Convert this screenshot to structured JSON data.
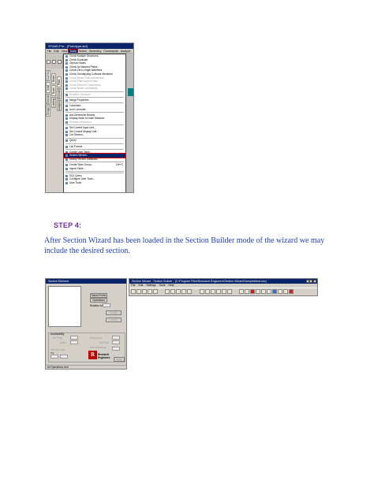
{
  "screenshot_menu": {
    "title": "STAAD.Pro - [Prototype.std]",
    "menubar": [
      "File",
      "Edit",
      "View",
      "Tools",
      "Select",
      "Geometry",
      "Commands",
      "Analyze",
      "Mode",
      "Window",
      "Help"
    ],
    "active_menu_index": 3,
    "vertical_tabs": [
      "Modeling",
      "Beam",
      "Plate",
      "Solid",
      "Node",
      "Geometry",
      "General",
      "Loading",
      "Analysis",
      "Design"
    ],
    "selected_tab_index": 0,
    "items": [
      {
        "label": "Check Multiple Structures...",
        "disabled": false
      },
      {
        "label": "Check Duplicate",
        "disabled": false
      },
      {
        "label": "Orphan Nodes",
        "disabled": false
      },
      {
        "label": "Check for Warped Plates...",
        "disabled": false
      },
      {
        "label": "Check Zero Length Members",
        "disabled": false
      },
      {
        "label": "Check Overlapping Collinear Members",
        "disabled": false
      },
      {
        "label": "Check Beam-Plate Intersection",
        "disabled": true
      },
      {
        "label": "Check Plate Aspect Ratio",
        "disabled": true
      },
      {
        "label": "Check Element Connectivity",
        "disabled": true
      },
      {
        "label": "Check Node Connectivity",
        "disabled": true
      },
      {
        "sep": true
      },
      {
        "label": "Redefine Structure",
        "disabled": true
      },
      {
        "sep": true
      },
      {
        "label": "Merge Properties",
        "disabled": false
      },
      {
        "sep": true
      },
      {
        "label": "Calculator...",
        "disabled": false
      },
      {
        "label": "Unit Converter...",
        "disabled": false
      },
      {
        "sep": true
      },
      {
        "label": "Ask Dimension Beams",
        "disabled": false
      },
      {
        "label": "Display Node to Node Distance",
        "disabled": false
      },
      {
        "label": "Remove Dimension",
        "disabled": true
      },
      {
        "sep": true
      },
      {
        "label": "Set Current Input Unit...",
        "disabled": false
      },
      {
        "label": "Set Current Display Unit...",
        "disabled": false
      },
      {
        "label": "Cut Section...",
        "disabled": false
      },
      {
        "sep": true
      },
      {
        "label": "Query",
        "disabled": false
      },
      {
        "sep": true
      },
      {
        "label": "List Format...",
        "disabled": false
      },
      {
        "sep": true
      },
      {
        "label": "Create User Table...",
        "disabled": false
      },
      {
        "label": "Section Wizard...",
        "disabled": false,
        "highlight": true
      },
      {
        "label": "Modify Section Database...",
        "disabled": false
      },
      {
        "sep": true
      },
      {
        "label": "Create Spec Group...",
        "disabled": false,
        "shortcut": "Ctrl+G"
      },
      {
        "label": "Import Table...",
        "disabled": false
      },
      {
        "sep": true
      },
      {
        "sep": true
      },
      {
        "label": "SQL Query",
        "disabled": false
      },
      {
        "label": "Configure User Tools...",
        "disabled": false
      },
      {
        "label": "User Tools",
        "disabled": false
      }
    ]
  },
  "step_label": "STEP 4:",
  "paragraph": "After Section Wizard has been loaded in the Section Builder mode of the wizard we may include the desired section.",
  "screenshot_dialog": {
    "title": "Section Element",
    "buttons": {
      "select_profile": "Select Profile",
      "operations": "Operations",
      "modify": "Modify",
      "delete": "Delete"
    },
    "rotation_label": "Rotation Angle",
    "group_title": "Accessibility",
    "labels": {
      "cut_point": "Cut Point",
      "width": "width",
      "edge_point": "Edge point",
      "with_fold": "with fold",
      "with_shift_along": "with shift along",
      "into_the_point": "into the point",
      "x_y": "x    y"
    },
    "apply_button": "Apply",
    "logo_mark": "R",
    "logo_line1": "Research",
    "logo_line2": "Engineers",
    "status": "All Operations   inch"
  },
  "screenshot_wizard": {
    "title": "Section Wizard - Section Builder - [C:\\Program Files\\Research Engineers\\Section Wizard\\Samples\\test.sec]",
    "menubar": [
      "File",
      "Edit",
      "Settings",
      "Tools",
      "Help"
    ]
  }
}
